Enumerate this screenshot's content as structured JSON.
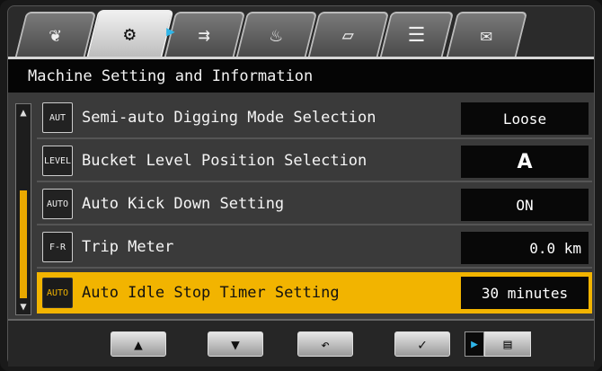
{
  "tabs": [
    {
      "icon": "leaf-icon",
      "glyph": "❦"
    },
    {
      "icon": "machine-settings-icon",
      "glyph": "⚙"
    },
    {
      "icon": "exhaust-icon",
      "glyph": "⇉"
    },
    {
      "icon": "heater-icon",
      "glyph": "♨"
    },
    {
      "icon": "manual-book-icon",
      "glyph": "▱"
    },
    {
      "icon": "menu-list-icon",
      "glyph": "☰"
    },
    {
      "icon": "mail-icon",
      "glyph": "✉"
    }
  ],
  "tab_arrow": "▶",
  "title": "Machine Setting and Information",
  "rows": [
    {
      "icon": "semi-auto-digging-icon",
      "icon_text": "AUT",
      "label": "Semi-auto Digging Mode Selection",
      "value": "Loose"
    },
    {
      "icon": "bucket-level-icon",
      "icon_text": "LEVEL",
      "label": "Bucket Level Position Selection",
      "value": "A"
    },
    {
      "icon": "auto-kick-down-icon",
      "icon_text": "AUTO",
      "label": "Auto Kick Down Setting",
      "value": "ON"
    },
    {
      "icon": "trip-meter-icon",
      "icon_text": "F-R",
      "label": "Trip Meter",
      "value": "0.0 km"
    },
    {
      "icon": "auto-idle-stop-icon",
      "icon_text": "AUTO",
      "label": "Auto Idle Stop Timer Setting",
      "value": "30 minutes"
    }
  ],
  "scrollbar": {
    "up": "▲",
    "down": "▼"
  },
  "buttons": {
    "up": "▲",
    "down": "▼",
    "back": "↶",
    "confirm": "✓",
    "menu_arrow": "▶",
    "menu": "▤"
  },
  "colors": {
    "accent": "#f2b400",
    "arrow": "#2fb5e8"
  }
}
